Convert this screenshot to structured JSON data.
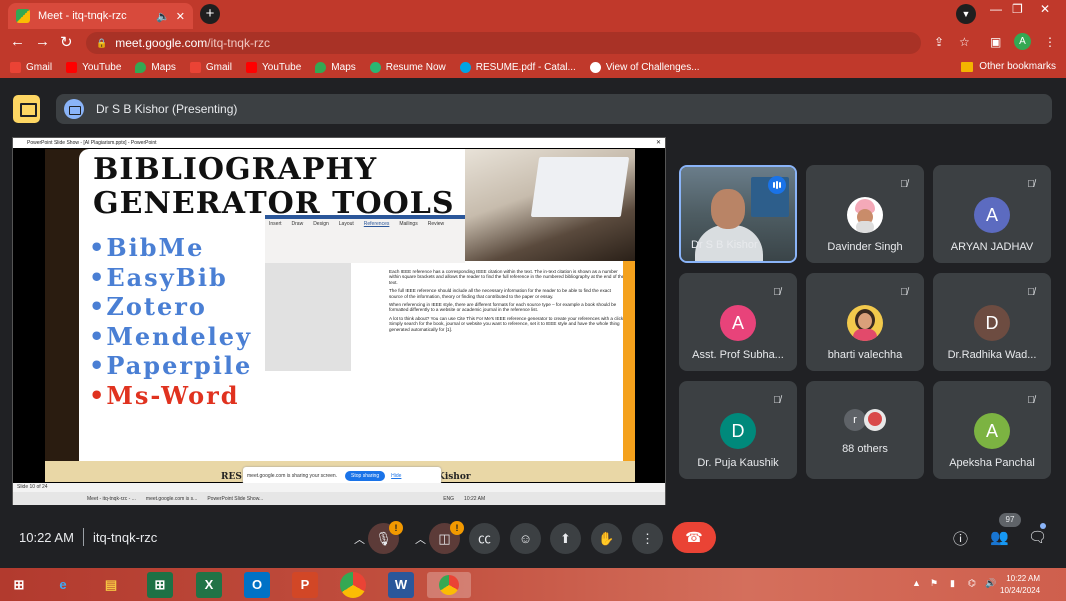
{
  "browser": {
    "tab_title": "Meet - itq-tnqk-rzc",
    "url_host": "meet.google.com",
    "url_path": "/itq-tnqk-rzc",
    "new_tab": "+",
    "profile_initial": "A",
    "bookmarks": [
      {
        "label": "Gmail",
        "color": "#ea4335"
      },
      {
        "label": "YouTube",
        "color": "#ff0000"
      },
      {
        "label": "Maps",
        "color": "#34a853"
      },
      {
        "label": "Gmail",
        "color": "#ea4335"
      },
      {
        "label": "YouTube",
        "color": "#ff0000"
      },
      {
        "label": "Maps",
        "color": "#34a853"
      },
      {
        "label": "Resume Now",
        "color": "#2bb673"
      },
      {
        "label": "RESUME.pdf - Catal...",
        "color": "#00a4e4"
      },
      {
        "label": "View of Challenges...",
        "color": "#ffffff"
      }
    ],
    "other_bookmarks": "Other bookmarks"
  },
  "meet": {
    "presenter_label": "Dr S B Kishor (Presenting)",
    "clock": "10:22 AM",
    "meeting_code": "itq-tnqk-rzc",
    "participant_count": "97"
  },
  "presentation": {
    "window_title": "PowerPoint Slide Show - [AI Plagiarism.pptx] - PowerPoint",
    "title_line1": "BIBLIOGRAPHY",
    "title_line2": "GENERATOR TOOLS",
    "bullets": [
      "•BibMe",
      "•EasyBib",
      "•Zotero",
      "•Mendeley",
      "•Paperpile",
      "•Ms-Word"
    ],
    "ribbon_tabs": [
      "Insert",
      "Draw",
      "Design",
      "Layout",
      "References",
      "Mailings",
      "Review"
    ],
    "doc_paragraphs": [
      "Each IEEE reference has a corresponding IEEE citation within the text. The in-text citation is shown as a number within square brackets and allows the reader to find the full reference in the numbered bibliography at the end of the text.",
      "The full IEEE reference should include all the necessary information for the reader to be able to find the exact source of the information, theory or finding that contributed to the paper or essay.",
      "When referencing in IEEE style, there are different formats for each source type – for example a book should be formatted differently to a website or academic journal in the reference list.",
      "A lot to think about? You can use Cite This For Me's IEEE reference generator to create your references with a click. Simply search for the book, journal or website you want to reference, set it to IEEE style and have the whole thing generated automatically for [1]."
    ],
    "share_text": "meet.google.com is sharing your screen.",
    "stop_sharing": "Stop sharing",
    "hide": "Hide",
    "res_text": "RES",
    "kishor_text": "Kishor",
    "slide_counter": "Slide 10 of 24",
    "taskbar_items": [
      "Meet - itq-tnqk-rzc - ...",
      "meet.google.com is s...",
      "PowerPoint Slide Show..."
    ],
    "tray_time": "10:22 AM",
    "tray_lang": "ENG"
  },
  "participants": [
    {
      "name": "Dr S B Kishor",
      "type": "video"
    },
    {
      "name": "Davinder Singh",
      "type": "photo"
    },
    {
      "name": "ARYAN JADHAV",
      "initial": "A",
      "color": "#5c6bc0"
    },
    {
      "name": "Asst. Prof Subha...",
      "initial": "A",
      "color": "#e8437a"
    },
    {
      "name": "bharti valechha",
      "type": "photo"
    },
    {
      "name": "Dr.Radhika Wad...",
      "initial": "D",
      "color": "#6d4c41"
    },
    {
      "name": "Dr. Puja Kaushik",
      "initial": "D",
      "color": "#00897b"
    },
    {
      "name": "88 others",
      "initial": "r",
      "color": "#5f6368"
    },
    {
      "name": "Apeksha Panchal",
      "initial": "A",
      "color": "#7cb342"
    }
  ],
  "taskbar": {
    "time": "10:22 AM",
    "date": "10/24/2024"
  }
}
